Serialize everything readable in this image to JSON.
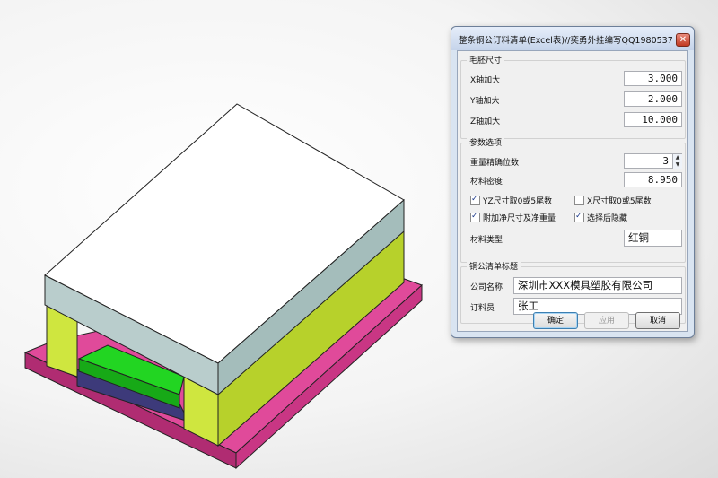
{
  "dialog": {
    "title": "整条铜公订料清单(Excel表)//奕勇外挂编写QQ1980537",
    "close_icon": "close-icon",
    "blank_size": {
      "title": "毛胚尺寸",
      "x_label": "X轴加大",
      "x_value": "3.000",
      "y_label": "Y轴加大",
      "y_value": "2.000",
      "z_label": "Z轴加大",
      "z_value": "10.000"
    },
    "options": {
      "title": "参数选项",
      "precision_label": "重量精确位数",
      "precision_value": "3",
      "density_label": "材料密度",
      "density_value": "8.950",
      "cb_yz_label": "YZ尺寸取0或5尾数",
      "cb_yz_checked": true,
      "cb_x_label": "X尺寸取0或5尾数",
      "cb_x_checked": false,
      "cb_net_label": "附加净尺寸及净重量",
      "cb_net_checked": true,
      "cb_hide_label": "选择后隐藏",
      "cb_hide_checked": true,
      "material_label": "材料类型",
      "material_value": "红铜"
    },
    "header": {
      "title": "铜公清单标题",
      "company_label": "公司名称",
      "company_value": "深圳市XXX模具塑胶有限公司",
      "orderer_label": "订料员",
      "orderer_value": "张工"
    },
    "buttons": {
      "ok": "确定",
      "apply": "应用",
      "cancel": "取消"
    }
  },
  "colors": {
    "top_face": "#ffffff",
    "upper_side": "#b8c9c9",
    "middle_block": "#c6e03a",
    "electrode": "#1fd11f",
    "base_plate": "#d63a8e"
  }
}
